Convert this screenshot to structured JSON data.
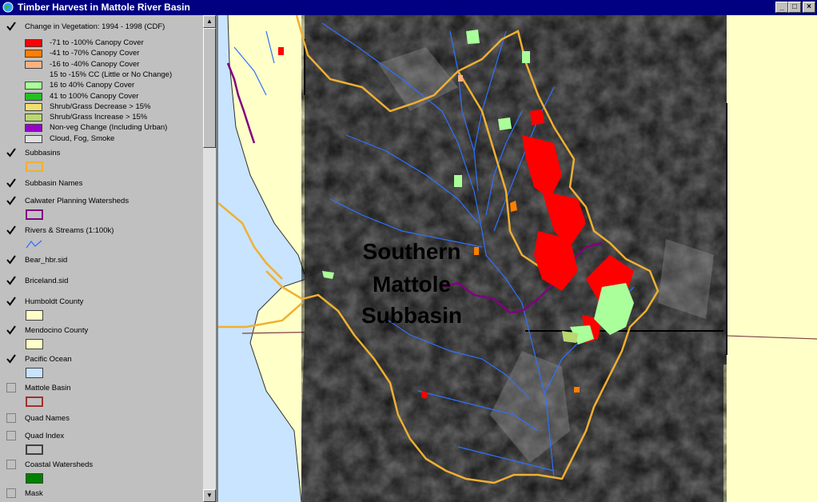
{
  "window": {
    "title": "Timber Harvest in Mattole River Basin"
  },
  "toc": {
    "vegetation_layer": {
      "name": "Change in Vegetation: 1994 - 1998 (CDF)",
      "checked": true,
      "legend": [
        {
          "label": "-71 to -100% Canopy Cover",
          "color": "#ff0000"
        },
        {
          "label": "-41 to -70% Canopy Cover",
          "color": "#ff7f00"
        },
        {
          "label": "-16 to -40% Canopy Cover",
          "color": "#ffb080"
        },
        {
          "label": "15 to -15% CC (Little or No Change)",
          "color": ""
        },
        {
          "label": "16 to 40% Canopy Cover",
          "color": "#aaff9a"
        },
        {
          "label": "41 to 100% Canopy Cover",
          "color": "#22c022"
        },
        {
          "label": "Shrub/Grass Decrease > 15%",
          "color": "#f0e070"
        },
        {
          "label": "Shrub/Grass Increase > 15%",
          "color": "#b8d870"
        },
        {
          "label": "Non-veg Change (Including Urban)",
          "color": "#9900cc"
        },
        {
          "label": "Cloud, Fog, Smoke",
          "color": "#e0e0e0"
        }
      ]
    },
    "layers": [
      {
        "name": "Subbasins",
        "checked": true,
        "symbol": "outline",
        "color": "#f0b030"
      },
      {
        "name": "Subbasin Names",
        "checked": true,
        "symbol": "none"
      },
      {
        "name": "Calwater Planning Watersheds",
        "checked": true,
        "symbol": "outline",
        "color": "#800080"
      },
      {
        "name": "Rivers & Streams (1:100k)",
        "checked": true,
        "symbol": "line",
        "color": "#3070ff"
      },
      {
        "name": "Bear_hbr.sid",
        "checked": true,
        "symbol": "none"
      },
      {
        "name": "Briceland.sid",
        "checked": true,
        "symbol": "none"
      },
      {
        "name": "Humboldt County",
        "checked": true,
        "symbol": "fill",
        "color": "#ffffc8"
      },
      {
        "name": "Mendocino County",
        "checked": true,
        "symbol": "fill",
        "color": "#ffffc8"
      },
      {
        "name": "Pacific Ocean",
        "checked": true,
        "symbol": "fill",
        "color": "#c8e4ff"
      },
      {
        "name": "Mattole Basin",
        "checked": false,
        "symbol": "outline",
        "color": "#a03030"
      },
      {
        "name": "Quad Names",
        "checked": false,
        "symbol": "none"
      },
      {
        "name": "Quad Index",
        "checked": false,
        "symbol": "outline",
        "color": "#404040"
      },
      {
        "name": "Coastal Watersheds",
        "checked": false,
        "symbol": "fill",
        "color": "#008000"
      },
      {
        "name": "Mask",
        "checked": false,
        "symbol": "none"
      }
    ]
  },
  "map": {
    "label_lines": [
      "Southern",
      "Mattole",
      "Subbasin"
    ],
    "colors": {
      "land": "#ffffc8",
      "ocean": "#c8e4ff",
      "imagery": "#6e6e6e",
      "subbasin": "#f0b030",
      "watershed": "#800080",
      "streams": "#3070ff"
    }
  }
}
